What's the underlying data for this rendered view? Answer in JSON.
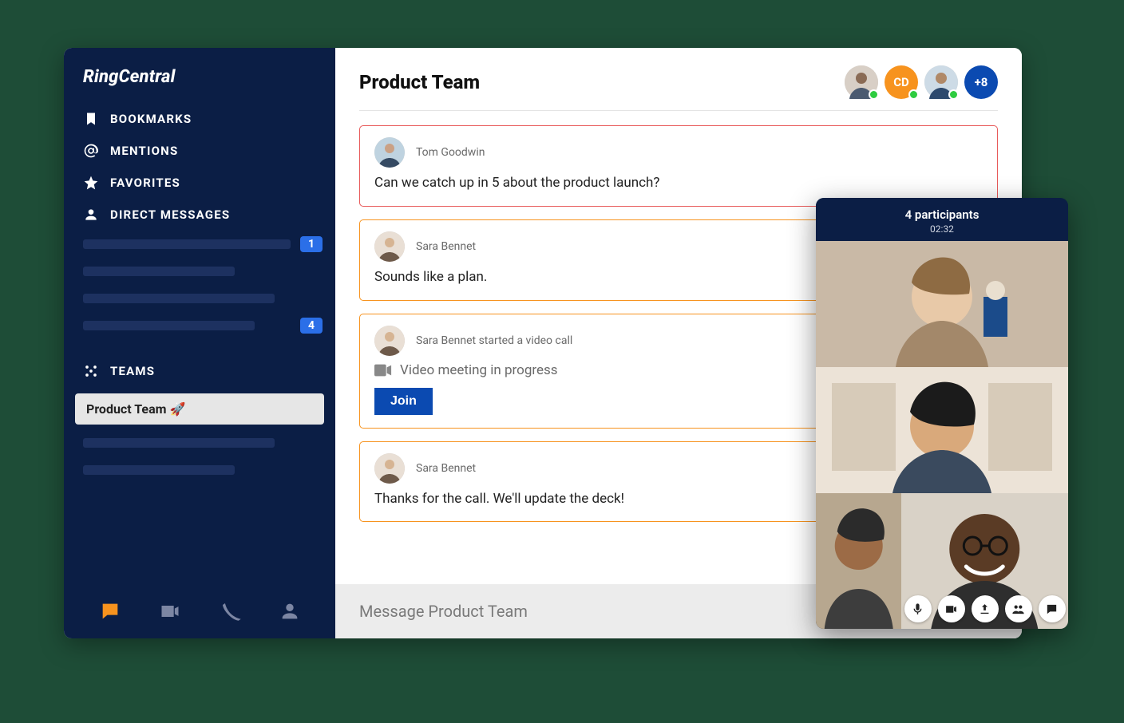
{
  "brand": "RingCentral",
  "sidebar": {
    "nav": {
      "bookmarks": "BOOKMARKS",
      "mentions": "MENTIONS",
      "favorites": "FAVORITES",
      "direct_messages": "DIRECT MESSAGES",
      "teams": "TEAMS"
    },
    "dm_badges": [
      "1",
      "4"
    ],
    "selected_team": "Product Team 🚀"
  },
  "header": {
    "title": "Product Team",
    "members": {
      "initials": "CD",
      "overflow": "+8"
    }
  },
  "messages": [
    {
      "author": "Tom Goodwin",
      "body": "Can we catch up in 5 about the product launch?",
      "border": "red"
    },
    {
      "author": "Sara Bennet",
      "body": "Sounds like a plan.",
      "border": "orange"
    },
    {
      "author": "Sara Bennet started a video call",
      "video_status": "Video meeting in progress",
      "join_label": "Join",
      "border": "orange",
      "is_video": true
    },
    {
      "author": "Sara Bennet",
      "body": "Thanks for the call. We'll update the deck!",
      "border": "orange"
    }
  ],
  "composer": {
    "placeholder": "Message Product Team"
  },
  "video_panel": {
    "participants_label": "4 participants",
    "timer": "02:32"
  }
}
